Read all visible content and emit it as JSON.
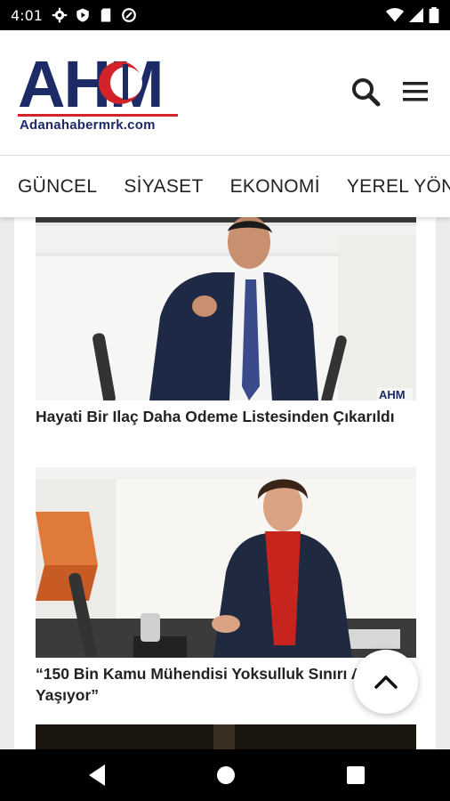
{
  "status": {
    "time": "4:01"
  },
  "brand": {
    "logo_text": "AHM",
    "logo_sub": "Adanahabermrk.com",
    "accent": "#d2232a",
    "navy": "#1c2a66"
  },
  "tabs": [
    {
      "label": "GÜNCEL"
    },
    {
      "label": "SİYASET"
    },
    {
      "label": "EKONOMİ"
    },
    {
      "label": "YEREL YÖN"
    }
  ],
  "articles": [
    {
      "title": "Hayati Bir Ilaç Daha Odeme Listesinden Çıkarıldı"
    },
    {
      "title": "“150 Bin Kamu Mühendisi Yoksulluk Sınırı Altında Yaşıyor”"
    }
  ],
  "image_watermark": "AHM",
  "icons": {
    "search": "search-icon",
    "menu": "menu-icon",
    "scroll_top": "chevron-up-icon"
  }
}
